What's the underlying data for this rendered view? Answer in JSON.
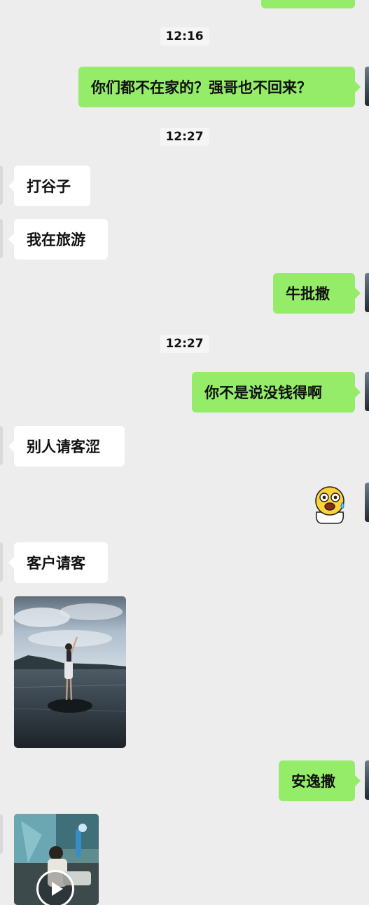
{
  "chat": {
    "messages": [
      {
        "type": "timestamp",
        "text": "12:16"
      },
      {
        "type": "text",
        "side": "out",
        "text": "你们都不在家的？强哥也不回来？"
      },
      {
        "type": "timestamp",
        "text": "12:27"
      },
      {
        "type": "text",
        "side": "in",
        "text": "打谷子"
      },
      {
        "type": "text",
        "side": "in",
        "text": "我在旅游"
      },
      {
        "type": "text",
        "side": "out",
        "text": "牛批撒"
      },
      {
        "type": "timestamp",
        "text": "12:27"
      },
      {
        "type": "text",
        "side": "out",
        "text": "你不是说没钱得啊"
      },
      {
        "type": "text",
        "side": "in",
        "text": "别人请客涩"
      },
      {
        "type": "sticker",
        "side": "out",
        "icon": "shocked-face-sticker"
      },
      {
        "type": "text",
        "side": "in",
        "text": "客户请客"
      },
      {
        "type": "image",
        "side": "in",
        "icon": "lake-photo"
      },
      {
        "type": "text",
        "side": "out",
        "text": "安逸撒"
      },
      {
        "type": "video",
        "side": "in",
        "icon": "video-thumbnail"
      }
    ]
  },
  "colors": {
    "background": "#ededed",
    "incoming_bubble": "#ffffff",
    "outgoing_bubble": "#95ec69"
  }
}
